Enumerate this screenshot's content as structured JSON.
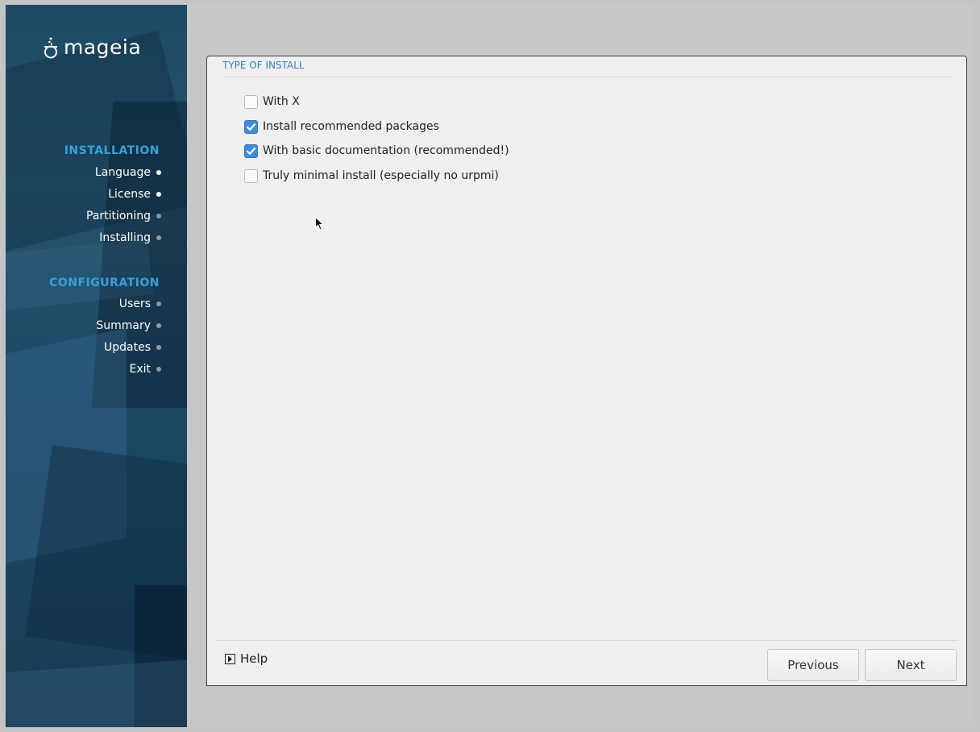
{
  "brand": {
    "logo_text": "mageia"
  },
  "sidebar": {
    "sections": [
      {
        "title": "INSTALLATION",
        "steps": [
          {
            "label": "Language",
            "status": "done"
          },
          {
            "label": "License",
            "status": "done"
          },
          {
            "label": "Partitioning",
            "status": "todo"
          },
          {
            "label": "Installing",
            "status": "todo"
          }
        ]
      },
      {
        "title": "CONFIGURATION",
        "steps": [
          {
            "label": "Users",
            "status": "todo"
          },
          {
            "label": "Summary",
            "status": "todo"
          },
          {
            "label": "Updates",
            "status": "todo"
          },
          {
            "label": "Exit",
            "status": "todo"
          }
        ]
      }
    ]
  },
  "panel": {
    "title": "TYPE OF INSTALL",
    "options": [
      {
        "label": "With X",
        "checked": false
      },
      {
        "label": "Install recommended packages",
        "checked": true
      },
      {
        "label": "With basic documentation (recommended!)",
        "checked": true
      },
      {
        "label": "Truly minimal install (especially no urpmi)",
        "checked": false
      }
    ]
  },
  "footer": {
    "help_label": "Help",
    "previous_label": "Previous",
    "next_label": "Next"
  },
  "colors": {
    "accent": "#33a3db",
    "checkbox_checked": "#3e8bd9",
    "panel_title": "#3a7fc4"
  }
}
